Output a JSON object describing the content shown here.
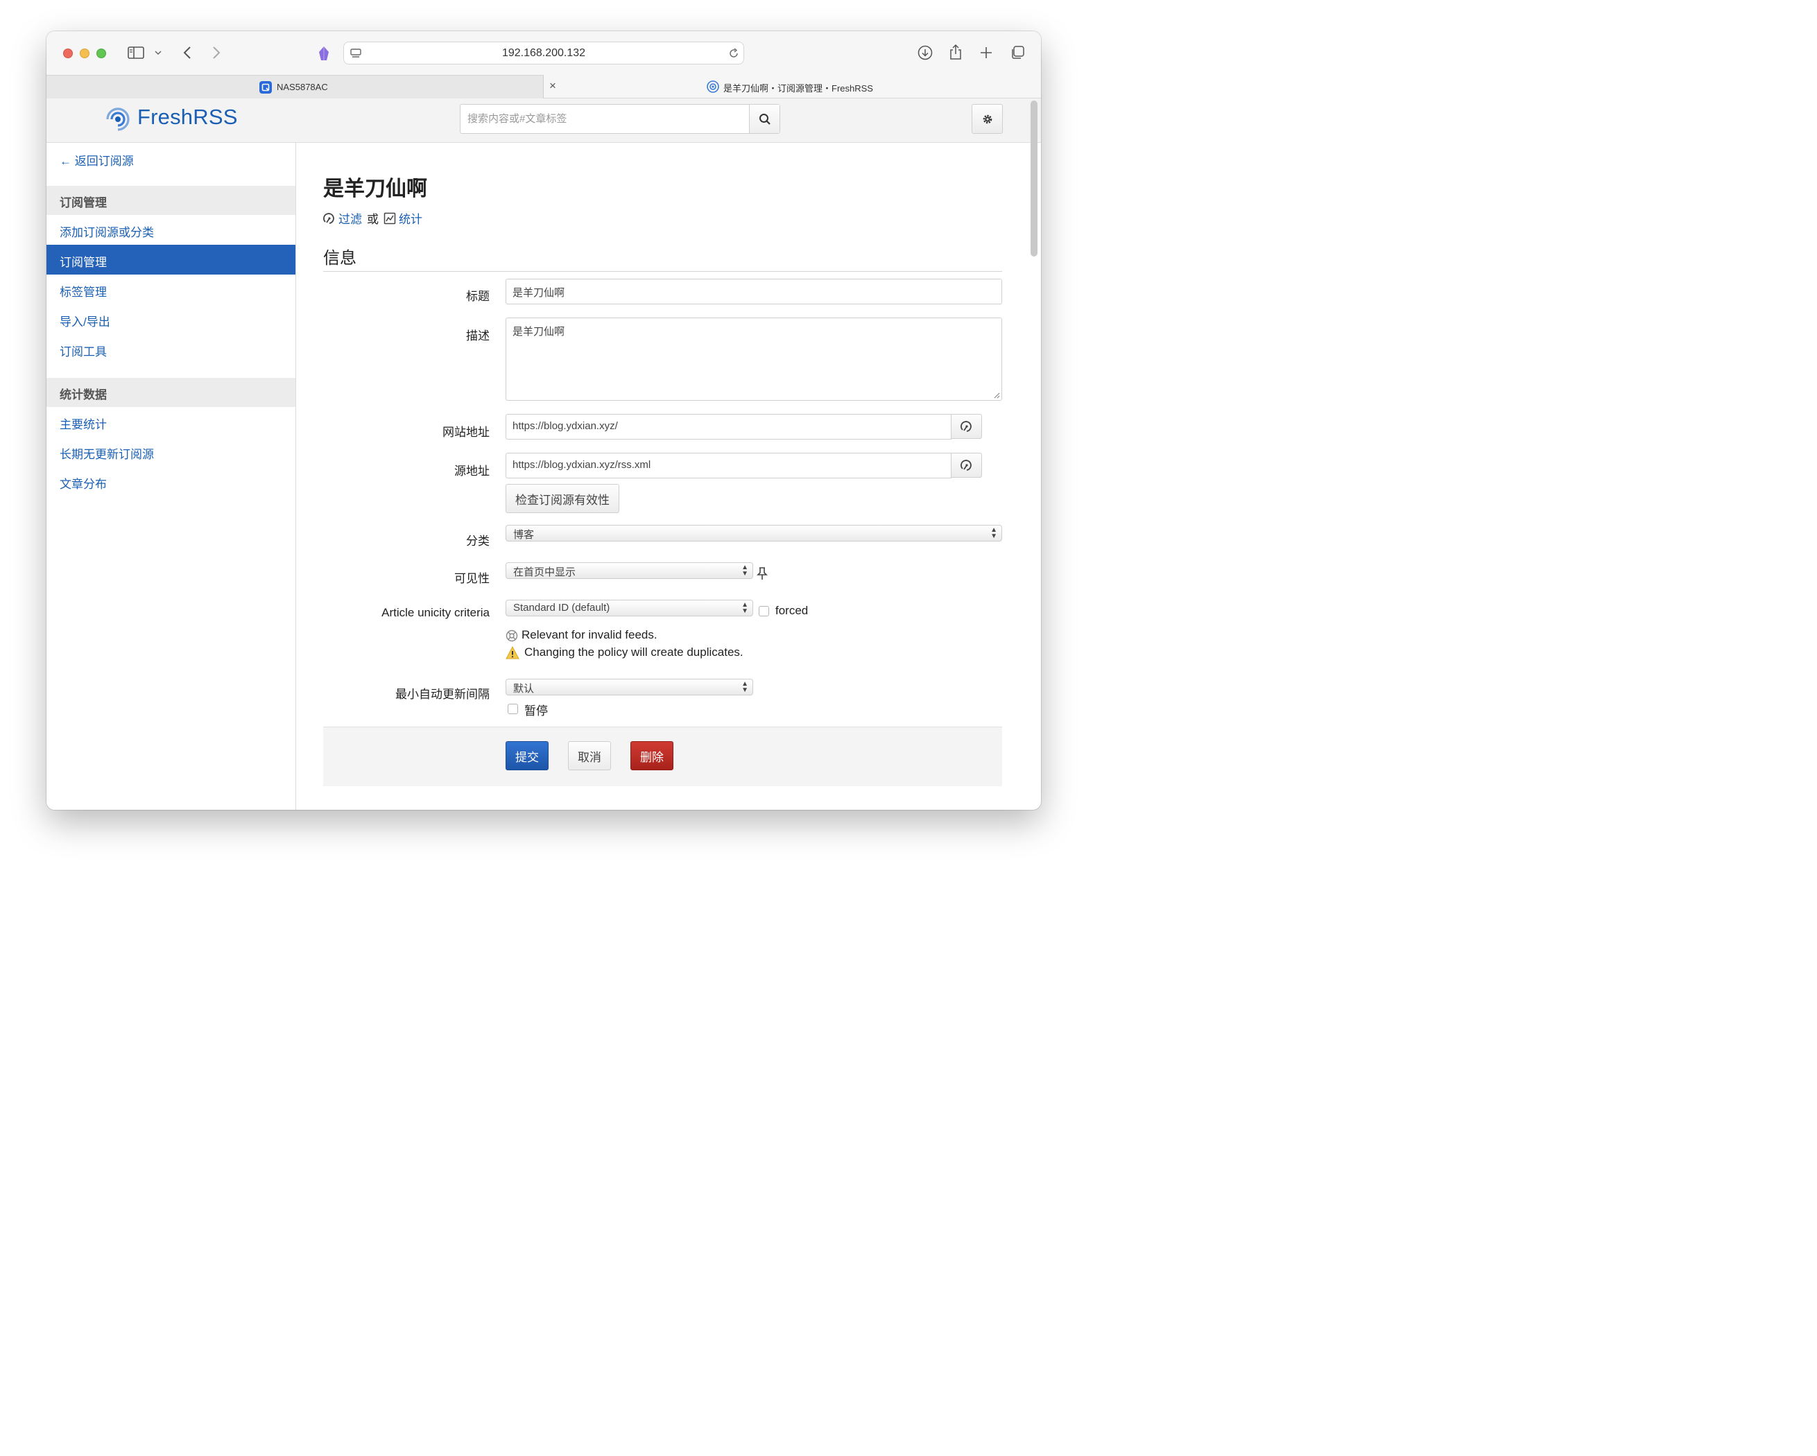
{
  "browser": {
    "address": "192.168.200.132",
    "tabs": [
      {
        "label": "NAS5878AC",
        "active": false
      },
      {
        "label": "是羊刀仙啊・订阅源管理・FreshRSS",
        "active": true
      }
    ],
    "tab_close_glyph": "×"
  },
  "app": {
    "logo": "FreshRSS",
    "search_placeholder": "搜索内容或#文章标签",
    "accent": "#2461b8"
  },
  "sidebar": {
    "back_link": "← 返回订阅源",
    "section1_title": "订阅管理",
    "section1_items": [
      {
        "label": "添加订阅源或分类",
        "active": false
      },
      {
        "label": "订阅管理",
        "active": true
      },
      {
        "label": "标签管理",
        "active": false
      },
      {
        "label": "导入/导出",
        "active": false
      },
      {
        "label": "订阅工具",
        "active": false
      }
    ],
    "section2_title": "统计数据",
    "section2_items": [
      {
        "label": "主要统计"
      },
      {
        "label": "长期无更新订阅源"
      },
      {
        "label": "文章分布"
      }
    ]
  },
  "main": {
    "title": "是羊刀仙啊",
    "subnav": {
      "filter": "过滤",
      "or": "或",
      "stats": "统计"
    },
    "section_title": "信息",
    "form": {
      "title_label": "标题",
      "title_value": "是羊刀仙啊",
      "desc_label": "描述",
      "desc_value": "是羊刀仙啊",
      "website_label": "网站地址",
      "website_value": "https://blog.ydxian.xyz/",
      "feed_label": "源地址",
      "feed_value": "https://blog.ydxian.xyz/rss.xml",
      "check_button": "检查订阅源有效性",
      "category_label": "分类",
      "category_value": "博客",
      "visibility_label": "可见性",
      "visibility_value": "在首页中显示",
      "unicity_label": "Article unicity criteria",
      "unicity_value": "Standard ID (default)",
      "forced_label": "forced",
      "forced_checked": false,
      "unicity_help": "Relevant for invalid feeds.",
      "unicity_warning": "Changing the policy will create duplicates.",
      "refresh_label": "最小自动更新间隔",
      "refresh_value": "默认",
      "pause_label": "暂停",
      "pause_checked": false
    },
    "actions": {
      "submit": "提交",
      "cancel": "取消",
      "delete": "删除"
    }
  },
  "colors": {
    "link": "#1a5fb4",
    "primary_button": "#2461b8",
    "danger_button": "#b8261f",
    "warning_icon": "#f2c94c"
  }
}
